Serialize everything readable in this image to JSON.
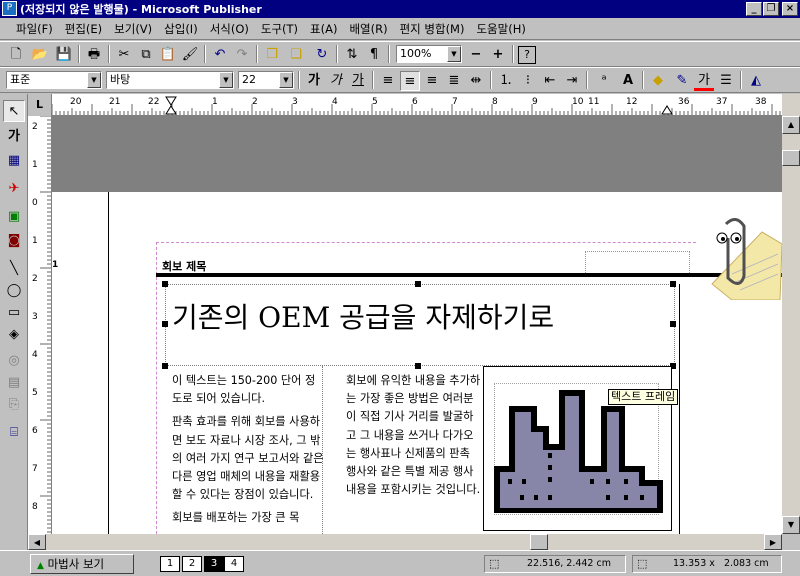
{
  "window": {
    "title": "(저장되지 않은 발행물) - Microsoft Publisher",
    "minimize": "_",
    "restore": "❐",
    "close": "×"
  },
  "menu": [
    "파일(F)",
    "편집(E)",
    "보기(V)",
    "삽입(I)",
    "서식(O)",
    "도구(T)",
    "표(A)",
    "배열(R)",
    "편지 병합(M)",
    "도움말(H)"
  ],
  "toolbar": {
    "zoom": "100%"
  },
  "format_bar": {
    "style": "표준",
    "font": "바탕",
    "size": "22",
    "char_buttons": [
      "가",
      "가",
      "가"
    ],
    "text_color_label": "가"
  },
  "left_tools": {
    "text_tool": "가"
  },
  "rulers": {
    "h_labels": [
      "20",
      "21",
      "22",
      "1",
      "2",
      "3",
      "4",
      "5",
      "6",
      "7",
      "8",
      "9",
      "10",
      "11",
      "12",
      "36",
      "37",
      "38"
    ],
    "v_labels": [
      "2",
      "1",
      "0",
      "1",
      "2",
      "3",
      "4",
      "5",
      "6",
      "7",
      "8"
    ],
    "corner": "L",
    "page_marker": "1"
  },
  "document": {
    "newsletter_label": "회보 제목",
    "headline": "기존의 OEM 공급을 자제하기로",
    "col1": [
      "이 텍스트는 150-200 단어 정도로 되어 있습니다.",
      "판촉 효과를 위해 회보를 사용하면 보도 자료나 시장 조사, 그 밖의 여러 가지 연구 보고서와 같은 다른 영업 매체의 내용을 재활용할 수 있다는 장점이 있습니다.",
      "회보를 배포하는 가장 큰 목"
    ],
    "col2": "회보에 유익한 내용을 추가하는 가장 좋은 방법은 여러분이 직접 기사 거리를 발굴하고 그 내용을 쓰거나 다가오는 행사표나 신제품의 판촉 행사와 같은 특별 제공 행사 내용을 포함시키는 것입니다.",
    "tooltip": "텍스트 프레임"
  },
  "status": {
    "wizard_button": "마법사 보기",
    "pages": [
      "1",
      "2",
      "3",
      "4"
    ],
    "position": "22.516, 2.442 cm",
    "size": "13.353 x   2.083 cm"
  },
  "colors": {
    "title_bar": "#000080",
    "workspace": "#808080",
    "illustration": "#8886a8"
  }
}
